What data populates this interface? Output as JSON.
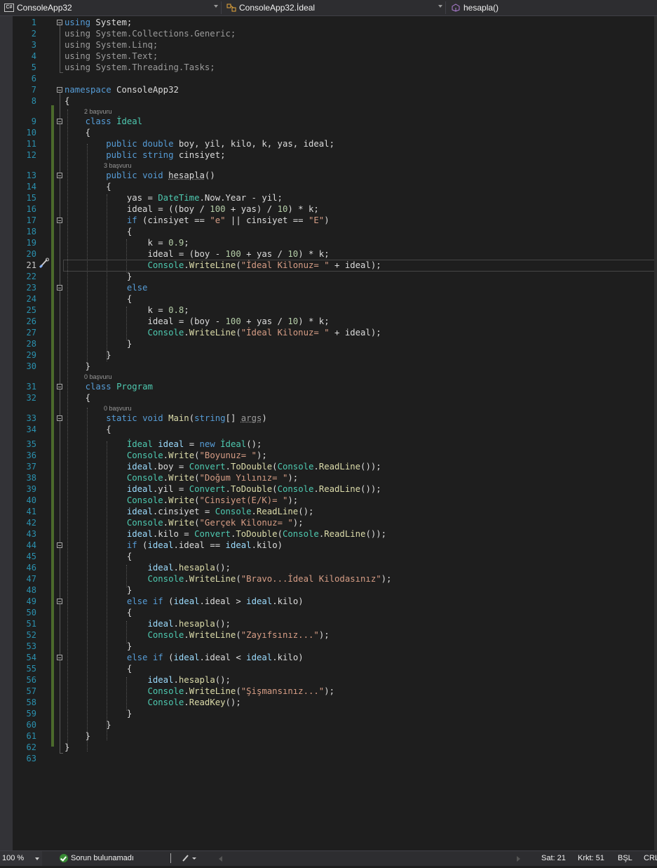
{
  "navbar": {
    "project": "ConsoleApp32",
    "class_path": "ConsoleApp32.İdeal",
    "member": "hesapla()",
    "project_icon": "csharp-project-icon",
    "class_icon": "class-icon",
    "member_icon": "method-icon"
  },
  "code": {
    "lines": [
      "1",
      "2",
      "3",
      "4",
      "5",
      "6",
      "7",
      "8",
      "9",
      "10",
      "11",
      "12",
      "13",
      "14",
      "15",
      "16",
      "17",
      "18",
      "19",
      "20",
      "21",
      "22",
      "23",
      "24",
      "25",
      "26",
      "27",
      "28",
      "29",
      "30",
      "31",
      "32",
      "33",
      "34",
      "35",
      "36",
      "37",
      "38",
      "39",
      "40",
      "41",
      "42",
      "43",
      "44",
      "45",
      "46",
      "47",
      "48",
      "49",
      "50",
      "51",
      "52",
      "53",
      "54",
      "55",
      "56",
      "57",
      "58",
      "59",
      "60",
      "61",
      "62",
      "63"
    ],
    "codelens": {
      "ideal_class_refs": "2 başvuru",
      "hesapla_refs": "3 başvuru",
      "program_class_refs": "0 başvuru",
      "main_refs": "0 başvuru"
    }
  },
  "status": {
    "zoom": "100 %",
    "issues": "Sorun bulunamadı",
    "line": "Sat: 21",
    "column": "Krkt: 51",
    "insert_mode": "BŞL",
    "line_ending": "CRL"
  },
  "colors": {
    "keyword": "#569cd6",
    "type": "#4ec9b0",
    "string": "#d69d85",
    "number": "#b5cea8",
    "line_number": "#2b91af",
    "changed_margin": "#4b6a2c"
  }
}
